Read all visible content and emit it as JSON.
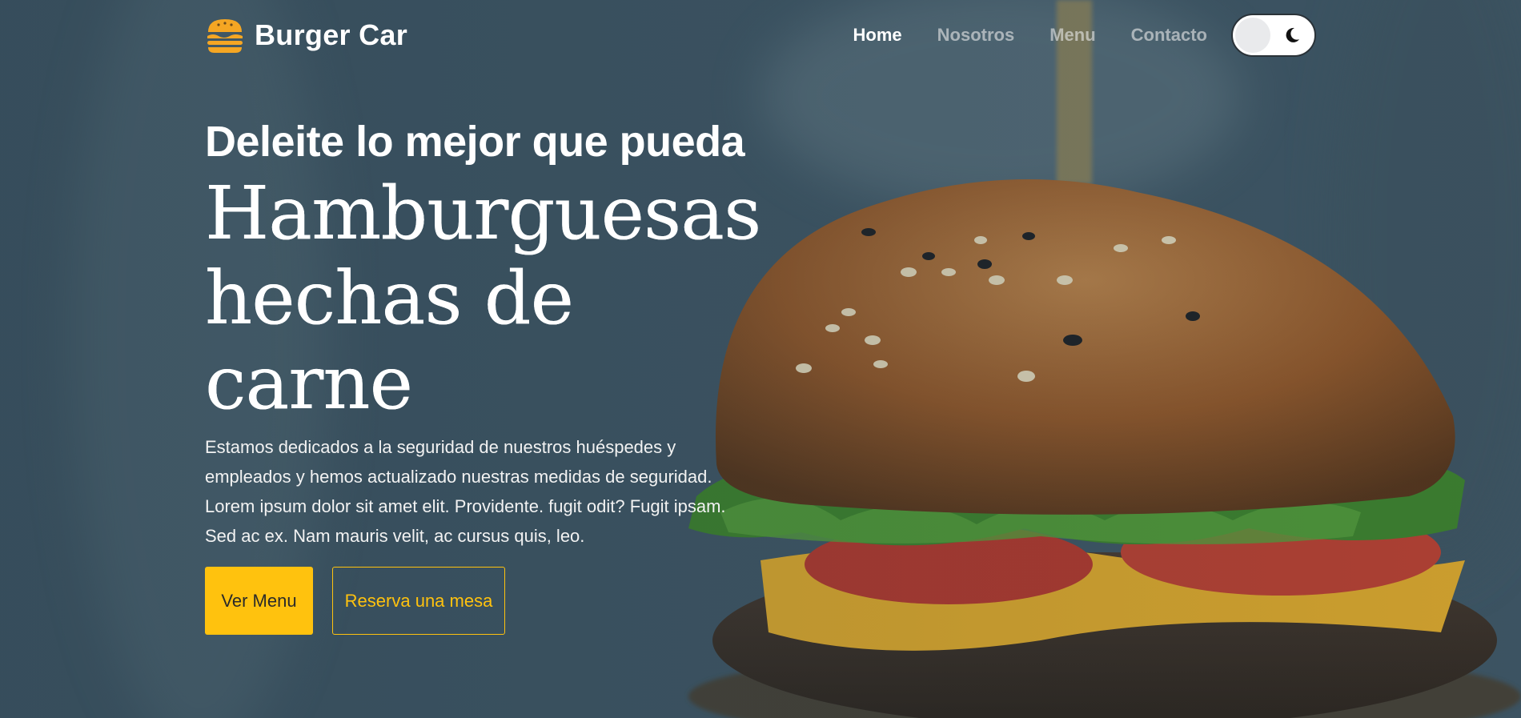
{
  "brand": {
    "name": "Burger Car",
    "icon": "burger-icon",
    "accent_color": "#f5a623"
  },
  "nav": {
    "items": [
      {
        "label": "Home",
        "active": true
      },
      {
        "label": "Nosotros",
        "active": false
      },
      {
        "label": "Menu",
        "active": false
      },
      {
        "label": "Contacto",
        "active": false
      }
    ],
    "theme_toggle": {
      "icon": "moon-icon",
      "state": "light"
    }
  },
  "hero": {
    "subtitle": "Deleite lo mejor que pueda",
    "title_lines": [
      "Hamburguesas",
      "hechas de",
      "carne"
    ],
    "description": "Estamos dedicados a la seguridad de nuestros huéspedes y empleados y hemos actualizado nuestras medidas de seguridad. Lorem ipsum dolor sit amet elit. Providente. fugit odit? Fugit ipsam. Sed ac ex. Nam mauris velit, ac cursus quis, leo.",
    "primary_button": "Ver Menu",
    "secondary_button": "Reserva una mesa",
    "button_color": "#ffc20e"
  }
}
